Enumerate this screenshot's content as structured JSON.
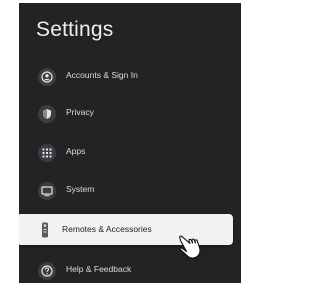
{
  "page": {
    "title": "Settings"
  },
  "menu": {
    "items": [
      {
        "label": "Accounts & Sign In",
        "icon": "account-circle-icon"
      },
      {
        "label": "Privacy",
        "icon": "shield-icon"
      },
      {
        "label": "Apps",
        "icon": "apps-grid-icon"
      },
      {
        "label": "System",
        "icon": "monitor-icon"
      },
      {
        "label": "Remotes & Accessories",
        "icon": "remote-icon",
        "selected": true
      },
      {
        "label": "Help & Feedback",
        "icon": "help-icon"
      }
    ]
  },
  "colors": {
    "panel_background": "#222325",
    "selected_background": "#f2f2f2",
    "text_light": "#dcdcdc",
    "text_dark": "#1e1e1e"
  }
}
